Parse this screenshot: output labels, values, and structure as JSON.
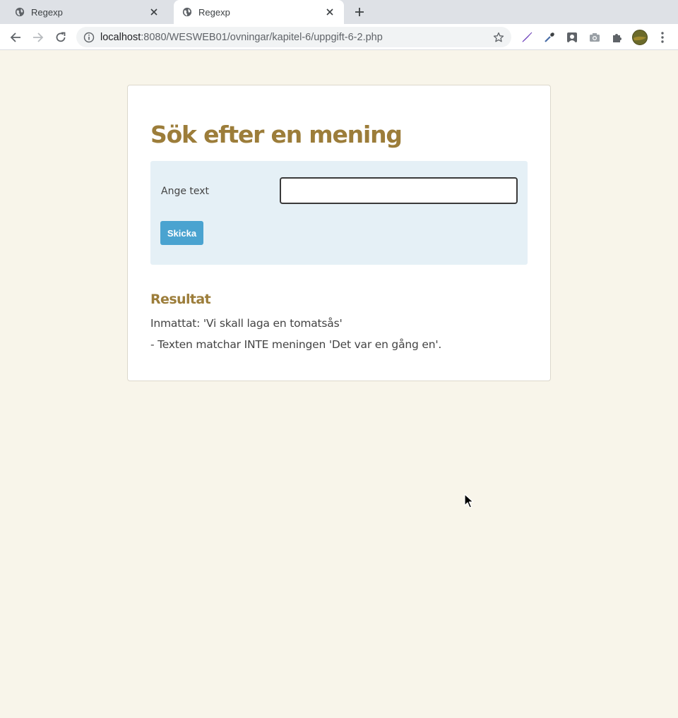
{
  "browser": {
    "tabs": [
      {
        "title": "Regexp",
        "active": false
      },
      {
        "title": "Regexp",
        "active": true
      }
    ],
    "url_host": "localhost",
    "url_rest": ":8080/WESWEB01/ovningar/kapitel-6/uppgift-6-2.php"
  },
  "page": {
    "heading": "Sök efter en mening",
    "form": {
      "label": "Ange text",
      "input_value": "",
      "submit_label": "Skicka"
    },
    "result": {
      "title": "Resultat",
      "input_line": "Inmattat: 'Vi skall laga en tomatsås'",
      "match_line": "- Texten matchar INTE meningen 'Det var en gång en'."
    }
  },
  "colors": {
    "page_bg": "#f8f5ea",
    "heading": "#9c7d3a",
    "form_bg": "#e5f0f6",
    "button": "#4aa3d0"
  }
}
